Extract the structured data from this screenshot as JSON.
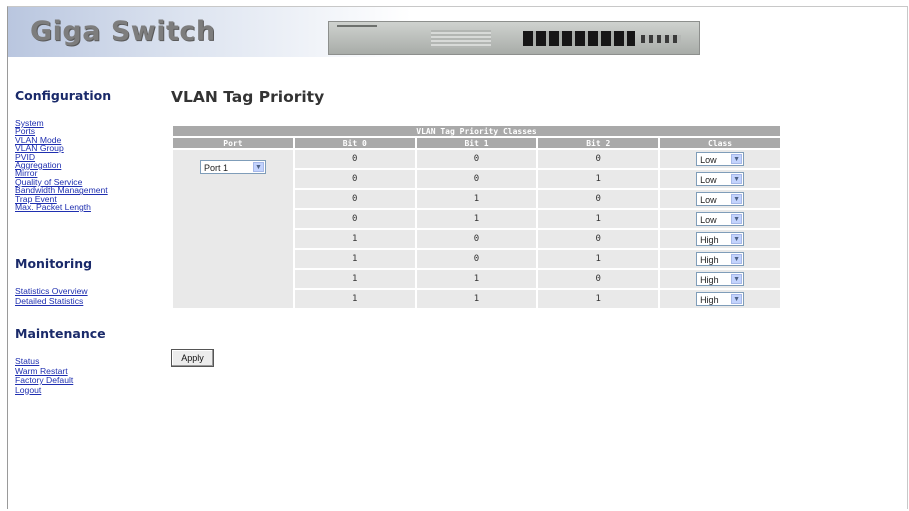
{
  "header": {
    "brand": "Giga Switch"
  },
  "sidebar": {
    "configuration": {
      "title": "Configuration",
      "links": [
        "System",
        "Ports",
        "VLAN Mode",
        "VLAN Group",
        "PVID",
        "Aggregation",
        "Mirror",
        "Quality of Service",
        "Bandwidth Management",
        "Trap Event",
        "Max. Packet Length"
      ]
    },
    "monitoring": {
      "title": "Monitoring",
      "links": [
        "Statistics Overview",
        "Detailed Statistics"
      ]
    },
    "maintenance": {
      "title": "Maintenance",
      "links": [
        "Status",
        "Warm Restart",
        "Factory Default",
        "Logout"
      ]
    }
  },
  "main": {
    "title": "VLAN Tag Priority",
    "table": {
      "caption": "VLAN Tag Priority Classes",
      "headers": [
        "Port",
        "Bit 0",
        "Bit 1",
        "Bit 2",
        "Class"
      ],
      "port_value": "Port 1",
      "rows": [
        {
          "bit0": "0",
          "bit1": "0",
          "bit2": "0",
          "class": "Low"
        },
        {
          "bit0": "0",
          "bit1": "0",
          "bit2": "1",
          "class": "Low"
        },
        {
          "bit0": "0",
          "bit1": "1",
          "bit2": "0",
          "class": "Low"
        },
        {
          "bit0": "0",
          "bit1": "1",
          "bit2": "1",
          "class": "Low"
        },
        {
          "bit0": "1",
          "bit1": "0",
          "bit2": "0",
          "class": "High"
        },
        {
          "bit0": "1",
          "bit1": "0",
          "bit2": "1",
          "class": "High"
        },
        {
          "bit0": "1",
          "bit1": "1",
          "bit2": "0",
          "class": "High"
        },
        {
          "bit0": "1",
          "bit1": "1",
          "bit2": "1",
          "class": "High"
        }
      ]
    },
    "apply_label": "Apply"
  },
  "colors": {
    "nav_link": "#1f2fb0",
    "table_header": "#a9a9a9",
    "table_cell": "#e9e9e9"
  }
}
